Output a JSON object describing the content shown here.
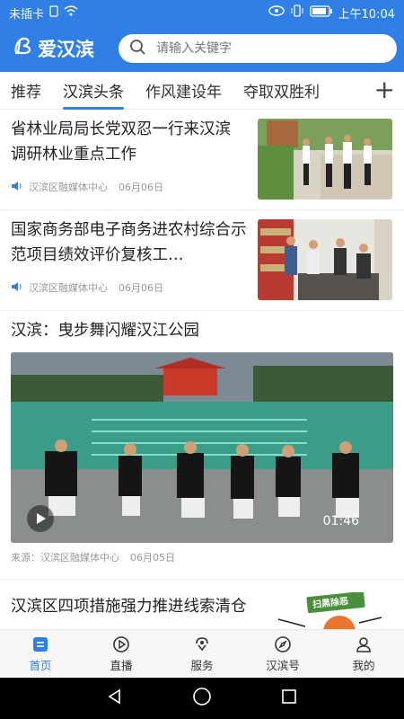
{
  "status_bar": {
    "carrier": "未插卡",
    "time": "上午10:04"
  },
  "header": {
    "logo_text": "爱汉滨",
    "search_placeholder": "请输入关键字"
  },
  "tabs": [
    {
      "label": "推荐"
    },
    {
      "label": "汉滨头条"
    },
    {
      "label": "作风建设年"
    },
    {
      "label": "夺取双胜利"
    }
  ],
  "add_tab_label": "+",
  "articles": [
    {
      "title": "省林业局局长党双忍一行来汉滨调研林业重点工作",
      "source": "汉滨区融媒体中心",
      "date": "06月06日"
    },
    {
      "title": "国家商务部电子商务进农村综合示范项目绩效评价复核工…",
      "source": "汉滨区融媒体中心",
      "date": "06月06日"
    }
  ],
  "video_article": {
    "title": "汉滨：曳步舞闪耀汉江公园",
    "duration": "01:46",
    "source_prefix": "来源：",
    "source": "汉滨区融媒体中心",
    "date": "06月05日"
  },
  "partial_article": {
    "title": "汉滨区四项措施强力推进线索清仓",
    "thumb_text": "扫黑除恶"
  },
  "bottom_nav": [
    {
      "label": "首页",
      "icon": "home-icon"
    },
    {
      "label": "直播",
      "icon": "live-icon"
    },
    {
      "label": "服务",
      "icon": "service-icon"
    },
    {
      "label": "汉滨号",
      "icon": "compass-icon"
    },
    {
      "label": "我的",
      "icon": "user-icon"
    }
  ],
  "colors": {
    "brand": "#2f7fe6",
    "text": "#222222",
    "meta": "#999999"
  }
}
